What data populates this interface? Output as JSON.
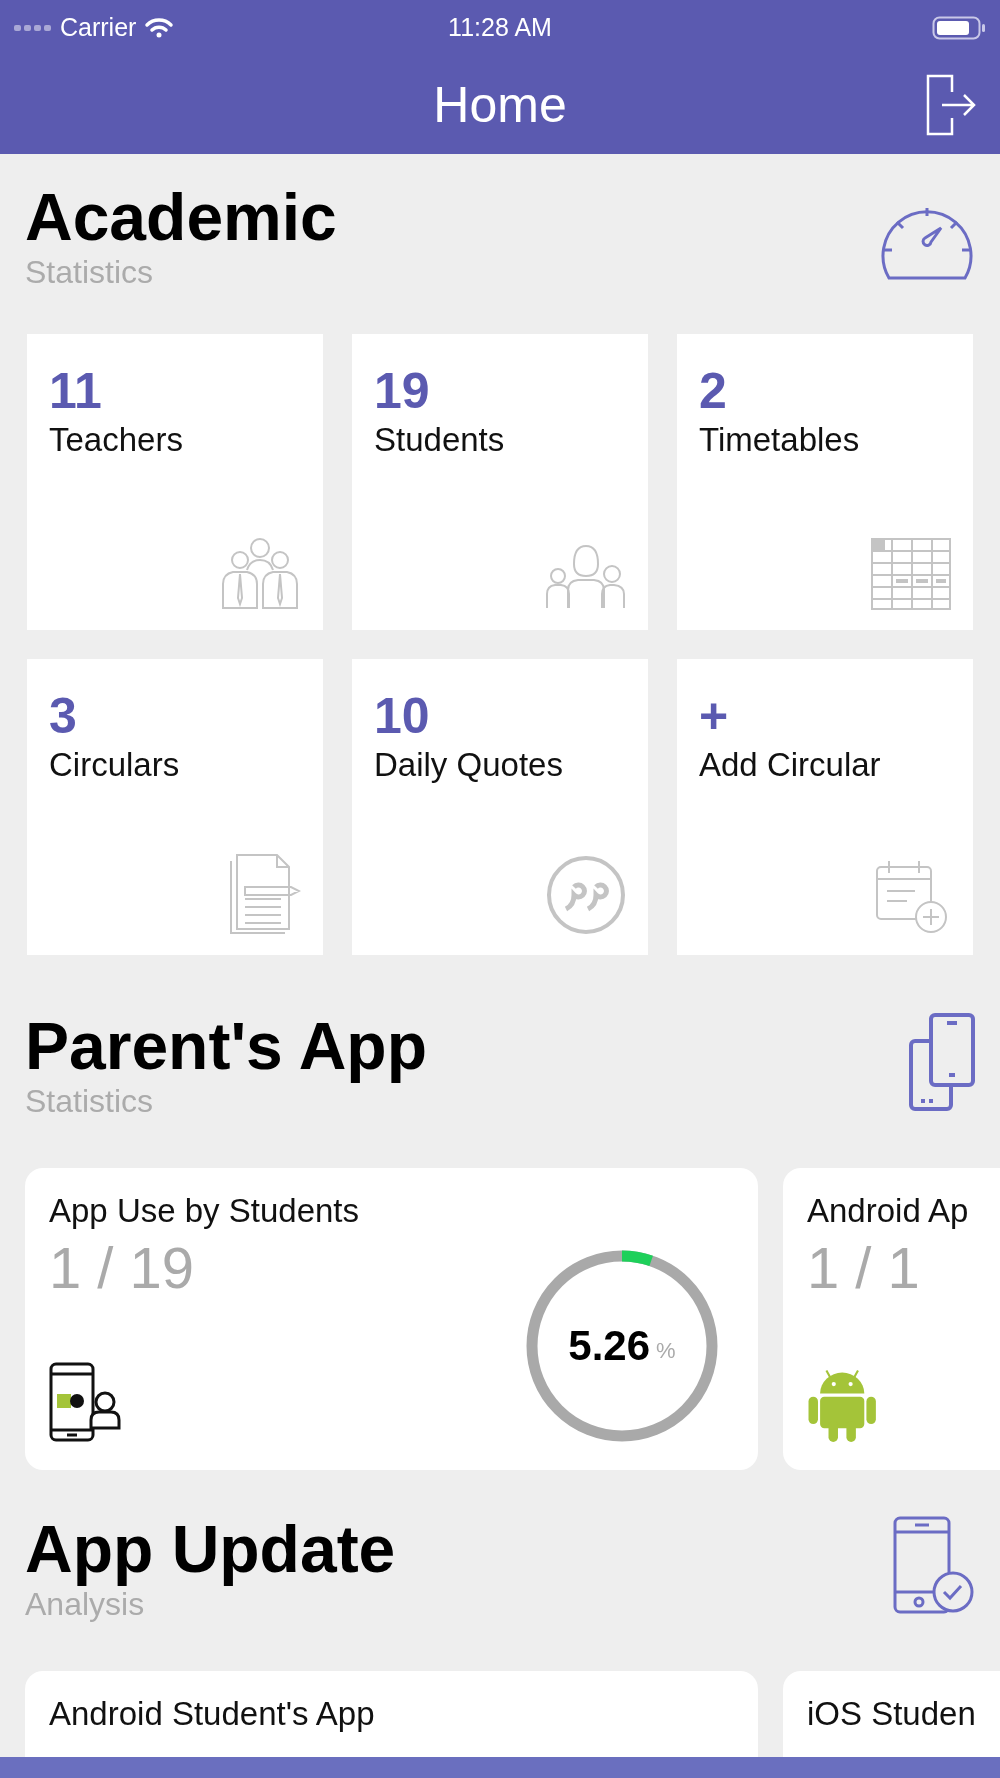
{
  "status_bar": {
    "carrier": "Carrier",
    "time": "11:28 AM"
  },
  "nav": {
    "title": "Home"
  },
  "sections": [
    {
      "title": "Academic",
      "subtitle": "Statistics",
      "kind": "tiles",
      "tiles": [
        {
          "value": "11",
          "label": "Teachers"
        },
        {
          "value": "19",
          "label": "Students"
        },
        {
          "value": "2",
          "label": "Timetables"
        },
        {
          "value": "3",
          "label": "Circulars"
        },
        {
          "value": "10",
          "label": "Daily Quotes"
        },
        {
          "value": "+",
          "label": "Add Circular"
        }
      ]
    },
    {
      "title": "Parent's App",
      "subtitle": "Statistics",
      "kind": "stats",
      "cards": [
        {
          "title": "App Use by Students",
          "fraction": "1 / 19",
          "progress": {
            "reading": "5.26",
            "unit": "%"
          }
        },
        {
          "title": "Android Ap",
          "fraction": "1 / 1"
        }
      ]
    },
    {
      "title": "App Update",
      "subtitle": "Analysis",
      "kind": "updates",
      "cards": [
        {
          "title": "Android Student's App"
        },
        {
          "title": "iOS Studen"
        }
      ]
    }
  ]
}
